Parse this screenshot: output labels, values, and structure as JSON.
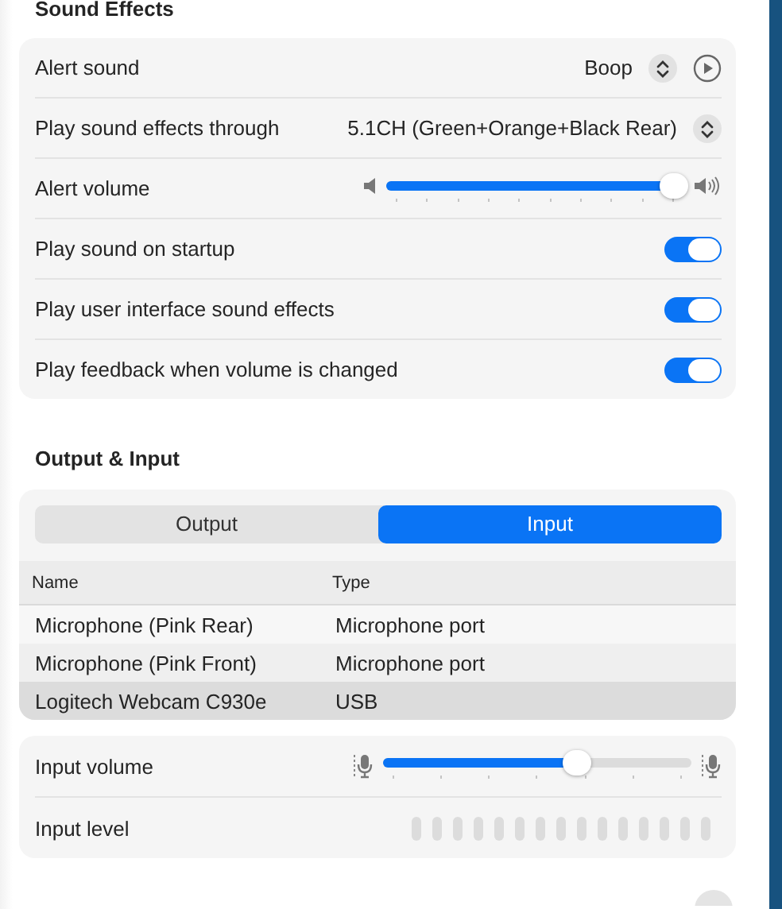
{
  "sound_effects": {
    "title": "Sound Effects",
    "rows": [
      {
        "kind": "popup",
        "label": "Alert sound",
        "value": "Boop",
        "play_button": true
      },
      {
        "kind": "popup",
        "label": "Play sound effects through",
        "value": "5.1CH (Green+Orange+Black Rear)",
        "play_button": false
      },
      {
        "kind": "slider",
        "label": "Alert volume",
        "level": 0.97
      },
      {
        "kind": "toggle",
        "label": "Play sound on startup",
        "on": true
      },
      {
        "kind": "toggle",
        "label": "Play user interface sound effects",
        "on": true
      },
      {
        "kind": "toggle",
        "label": "Play feedback when volume is changed",
        "on": true
      }
    ]
  },
  "output_input": {
    "title": "Output & Input",
    "tabs": [
      {
        "label": "Output",
        "selected": false
      },
      {
        "label": "Input",
        "selected": true
      }
    ],
    "table": {
      "columns": [
        "Name",
        "Type"
      ],
      "rows": [
        {
          "cells": [
            "Microphone (Pink Rear)",
            "Microphone port"
          ],
          "selected": false
        },
        {
          "cells": [
            "Microphone (Pink Front)",
            "Microphone port"
          ],
          "selected": false
        },
        {
          "cells": [
            "Logitech Webcam C930e",
            "USB"
          ],
          "selected": true
        }
      ]
    }
  },
  "input": {
    "volume": {
      "label": "Input volume",
      "level": 0.63
    },
    "meter": {
      "label": "Input level"
    }
  }
}
